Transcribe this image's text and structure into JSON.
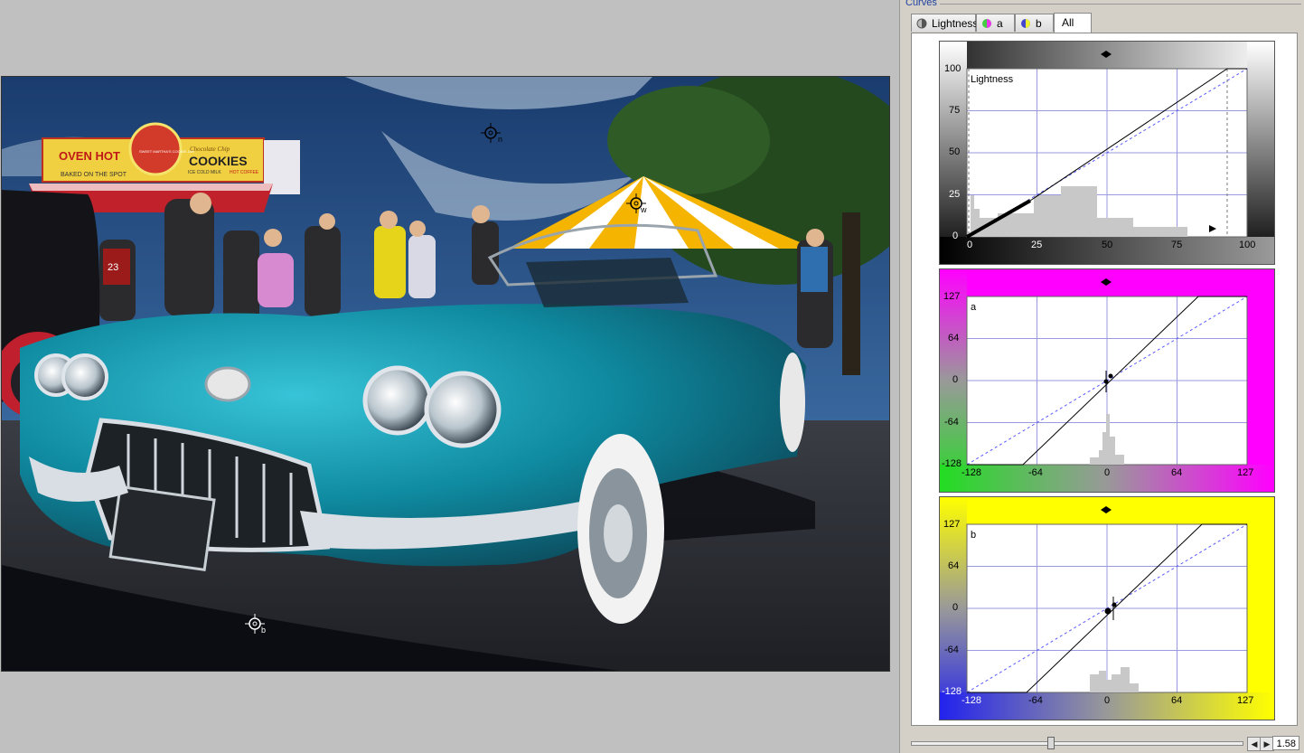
{
  "panel": {
    "title": "Curves",
    "zoom_value": "1.58",
    "scroll_left_icon": "left-arrow-icon",
    "scroll_right_icon": "right-arrow-icon"
  },
  "tabs": [
    {
      "label": "Lightness",
      "icon": "lightness-channel-icon",
      "active": false
    },
    {
      "label": "a",
      "icon": "a-channel-icon",
      "active": false
    },
    {
      "label": "b",
      "icon": "b-channel-icon",
      "active": false
    },
    {
      "label": "All",
      "icon": "",
      "active": true
    }
  ],
  "photo": {
    "sign_left_1": "OVEN HOT",
    "sign_left_2": "BAKED ON THE SPOT",
    "sign_mid": "SWEET MARTHA'S COOKIE JAR",
    "sign_right_1": "Chocolate Chip",
    "sign_right_2": "COOKIES",
    "sign_right_3": "ICE COLD MILK",
    "sign_right_4": "HOT COFFEE",
    "jersey": "23",
    "markers": [
      {
        "label": "n",
        "icon": "crosshair-icon"
      },
      {
        "label": "w",
        "icon": "crosshair-icon"
      },
      {
        "label": "b",
        "icon": "crosshair-icon"
      }
    ]
  },
  "curves": [
    {
      "name": "Lightness",
      "label": "Lightness",
      "color": "#808080",
      "y_ticks": [
        "100",
        "75",
        "50",
        "25",
        "0"
      ],
      "x_ticks": [
        "0",
        "25",
        "50",
        "75",
        "100"
      ]
    },
    {
      "name": "a",
      "label": "a",
      "color": "#ff00ff",
      "y_ticks": [
        "127",
        "64",
        "0",
        "-64",
        "-128"
      ],
      "x_ticks": [
        "-128",
        "-64",
        "0",
        "64",
        "127"
      ]
    },
    {
      "name": "b",
      "label": "b",
      "color": "#ffff00",
      "y_ticks": [
        "127",
        "64",
        "0",
        "-64",
        "-128"
      ],
      "x_ticks": [
        "-128",
        "-64",
        "0",
        "64",
        "127"
      ]
    }
  ]
}
